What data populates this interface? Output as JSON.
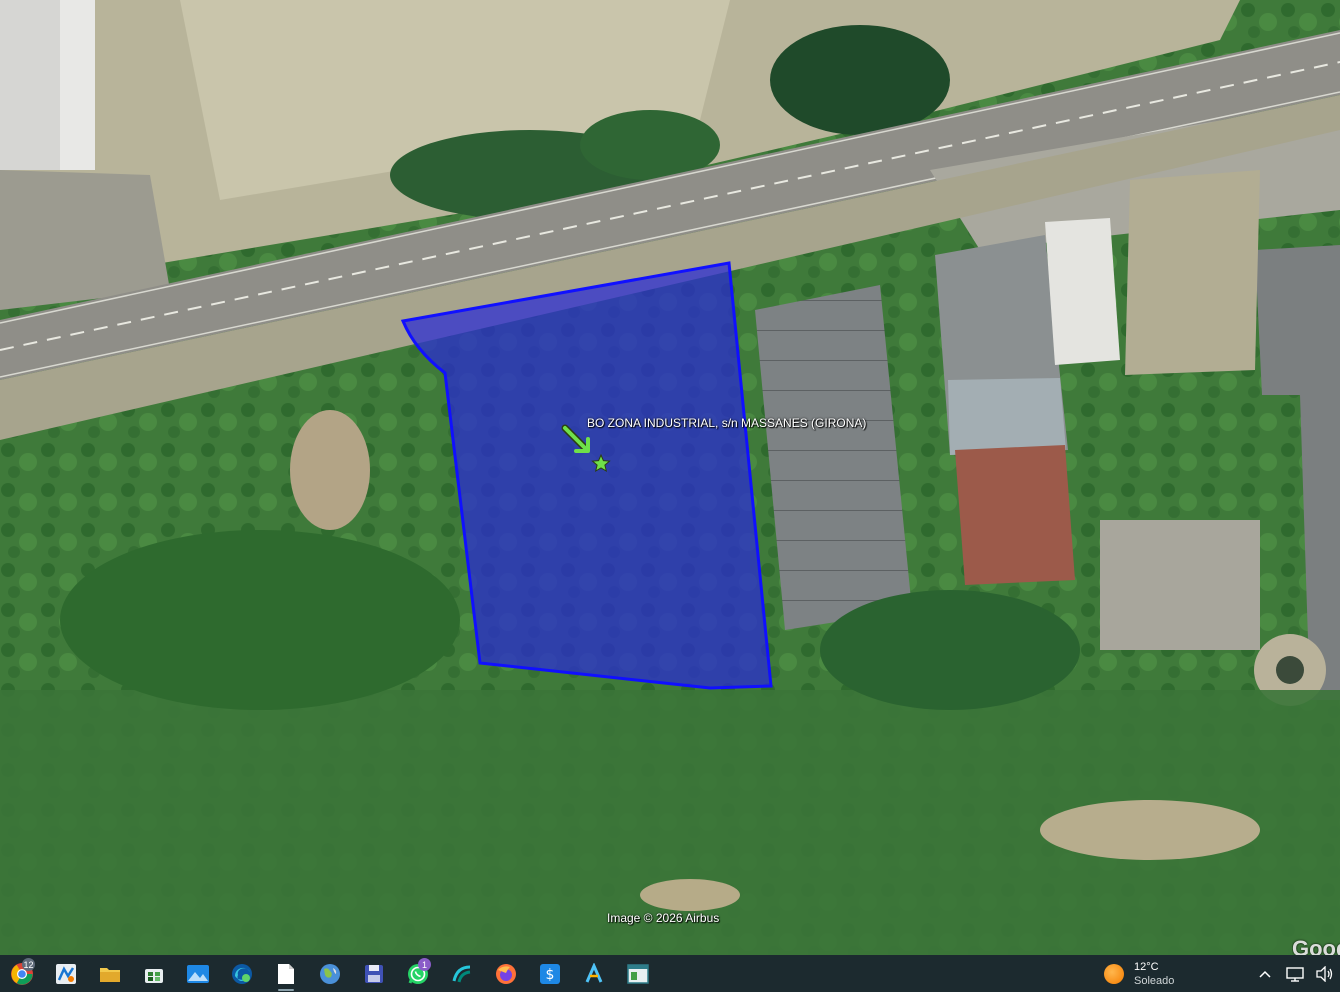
{
  "map": {
    "placemark_label": "BO ZONA INDUSTRIAL, s/n MASSANES (GIRONA)",
    "attribution": "Image © 2026 Airbus",
    "provider_mark": "Google",
    "polygon_fill": "#2a2ad6",
    "polygon_stroke": "#1010ff",
    "marker_color": "#6fe04a"
  },
  "taskbar": {
    "apps": [
      {
        "name": "chrome-icon",
        "badge": ""
      },
      {
        "name": "maps-app-icon",
        "badge": ""
      },
      {
        "name": "file-explorer-icon",
        "badge": ""
      },
      {
        "name": "store-icon",
        "badge": ""
      },
      {
        "name": "photos-icon",
        "badge": ""
      },
      {
        "name": "edge-icon",
        "badge": ""
      },
      {
        "name": "notepad-icon",
        "badge": ""
      },
      {
        "name": "google-earth-icon",
        "badge": ""
      },
      {
        "name": "save-app-icon",
        "badge": ""
      },
      {
        "name": "whatsapp-icon",
        "badge": "1"
      },
      {
        "name": "app-wave-icon",
        "badge": ""
      },
      {
        "name": "firefox-icon",
        "badge": ""
      },
      {
        "name": "app-dollar-icon",
        "badge": ""
      },
      {
        "name": "app-a-icon",
        "badge": ""
      },
      {
        "name": "app-window-icon",
        "badge": ""
      }
    ],
    "chrome_badge": "12"
  },
  "weather": {
    "temperature": "12°C",
    "condition": "Soleado"
  }
}
